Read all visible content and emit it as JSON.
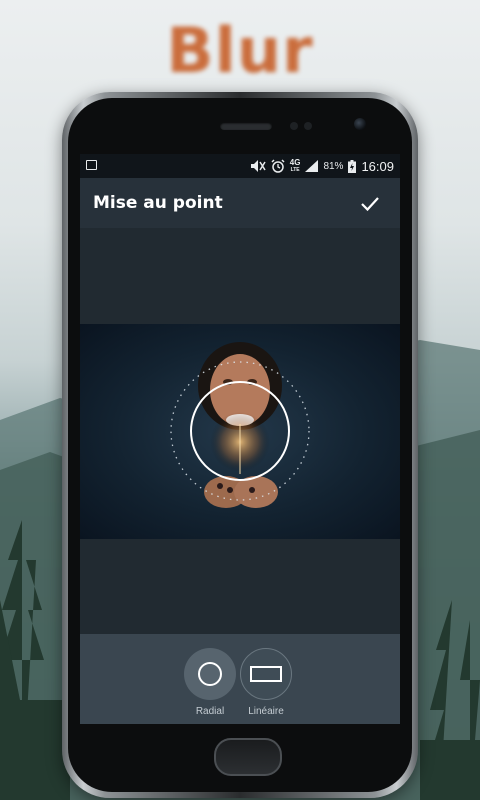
{
  "promo": {
    "title": "Blur"
  },
  "status_bar": {
    "network_type": "4G",
    "network_sub": "LTE",
    "battery_percent": "81%",
    "time": "16:09"
  },
  "toolbar": {
    "title": "Mise au point"
  },
  "tools": [
    {
      "label": "Radial",
      "selected": true
    },
    {
      "label": "Linéaire",
      "selected": false
    }
  ],
  "colors": {
    "promo_title": "#c7602a",
    "toolbar_bg": "#27313a",
    "panel_bg": "#3a4650"
  },
  "icons": [
    "gallery-icon",
    "mute-icon",
    "alarm-icon",
    "signal-icon",
    "battery-icon",
    "check-icon",
    "circle-icon",
    "rectangle-icon"
  ]
}
